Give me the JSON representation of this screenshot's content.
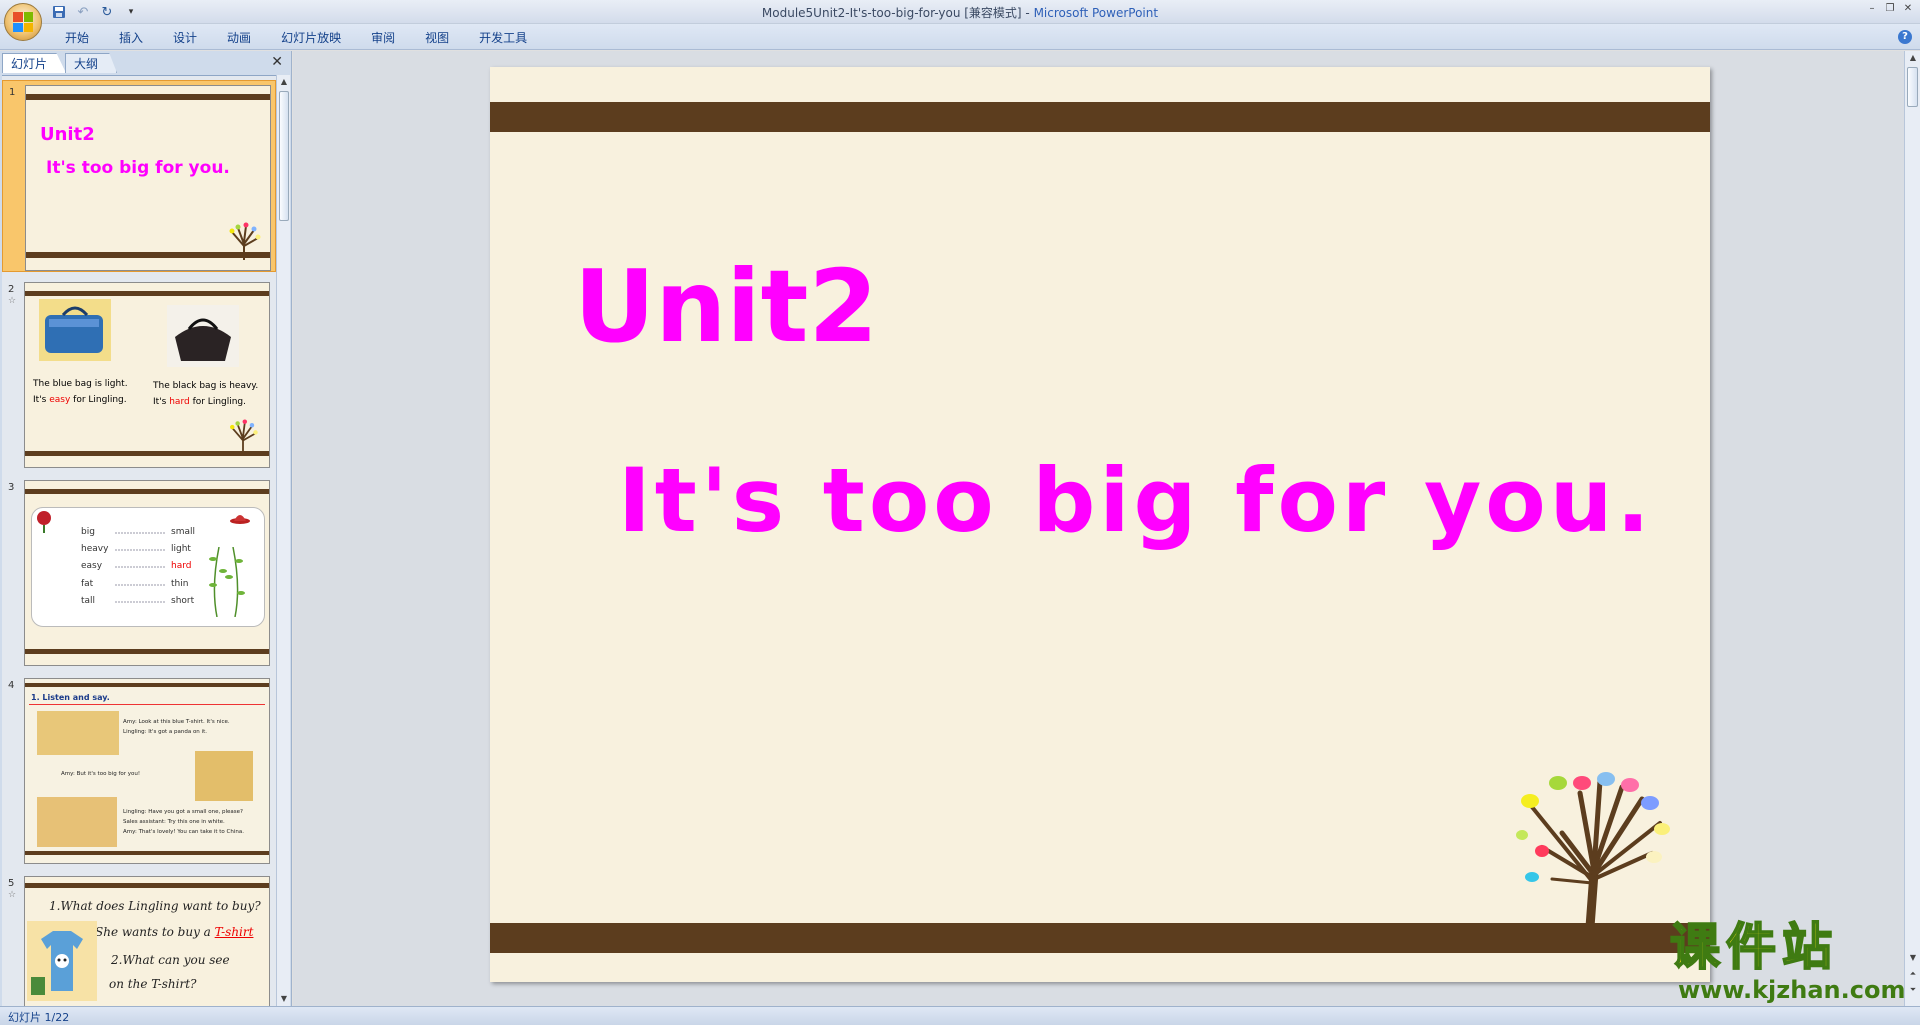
{
  "window": {
    "title": "Module5Unit2-It's-too-big-for-you [兼容模式] - ",
    "app_name": "Microsoft PowerPoint"
  },
  "ribbon": {
    "tabs": [
      "开始",
      "插入",
      "设计",
      "动画",
      "幻灯片放映",
      "审阅",
      "视图",
      "开发工具"
    ]
  },
  "left_panel": {
    "tabs": [
      "幻灯片",
      "大纲"
    ],
    "close": "✕"
  },
  "thumbnails": [
    {
      "num": "1",
      "line1": "Unit2",
      "line2": "It's too big for you."
    },
    {
      "num": "2",
      "left_line1": "The blue bag is light.",
      "left_line2a": "It's ",
      "left_line2b": "easy",
      "left_line2c": " for Lingling.",
      "right_line1": "The black bag is heavy.",
      "right_line2a": "It's ",
      "right_line2b": "hard",
      "right_line2c": " for Lingling."
    },
    {
      "num": "3",
      "left_words": [
        "big",
        "heavy",
        "easy",
        "fat",
        "tall"
      ],
      "right_words": [
        "small",
        "light",
        "hard",
        "thin",
        "short"
      ]
    },
    {
      "num": "4",
      "heading": "1. Listen and say.",
      "lines": [
        "Amy: Look at this blue T-shirt. It's nice.",
        "Lingling: It's got a panda on it.",
        "Amy: But it's too big for you!",
        "Lingling: Have you got a small one, please?",
        "Sales assistant: Try this one in white.",
        "Amy: That's lovely! You can take it to China."
      ]
    },
    {
      "num": "5",
      "q1": "1.What does Lingling want to buy?",
      "a1a": "She wants to buy a ",
      "a1b": "T-shirt",
      "q2a": "2.What can you see",
      "q2b": "on the T-shirt?"
    }
  ],
  "slide": {
    "title": "Unit2",
    "subtitle": "It's too big for you."
  },
  "status": {
    "text": "幻灯片 1/22"
  },
  "watermark": {
    "cn": "课件站",
    "url": "www.kjzhan.com"
  },
  "colors": {
    "band": "#5c3d1e",
    "slide_bg": "#f8f1de",
    "title_color": "#ff00ff",
    "selection": "#f9c66b"
  }
}
